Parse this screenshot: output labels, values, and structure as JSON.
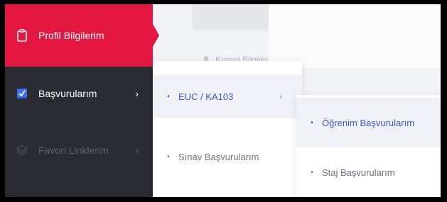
{
  "sidebar": {
    "items": [
      {
        "label": "Profil Bilgilerim",
        "icon": "clipboard-icon"
      },
      {
        "label": "Başvurularım",
        "icon": "checkbox-icon",
        "chevron": "›"
      },
      {
        "label": "Favori Linklerim",
        "icon": "layers-icon",
        "chevron": "›"
      }
    ]
  },
  "background": {
    "personal_label": "Kişisel Bilgiler"
  },
  "submenu": {
    "items": [
      {
        "label": "EUC / KA103",
        "chevron": "›"
      },
      {
        "label": "Sınav Başvurularım"
      }
    ]
  },
  "subsubmenu": {
    "items": [
      {
        "label": "Öğrenim Başvurularım"
      },
      {
        "label": "Staj Başvurularım"
      }
    ]
  },
  "colors": {
    "accent": "#e3173f",
    "sidebar_bg": "#2b2c33",
    "link_blue": "#3b5ac9"
  }
}
